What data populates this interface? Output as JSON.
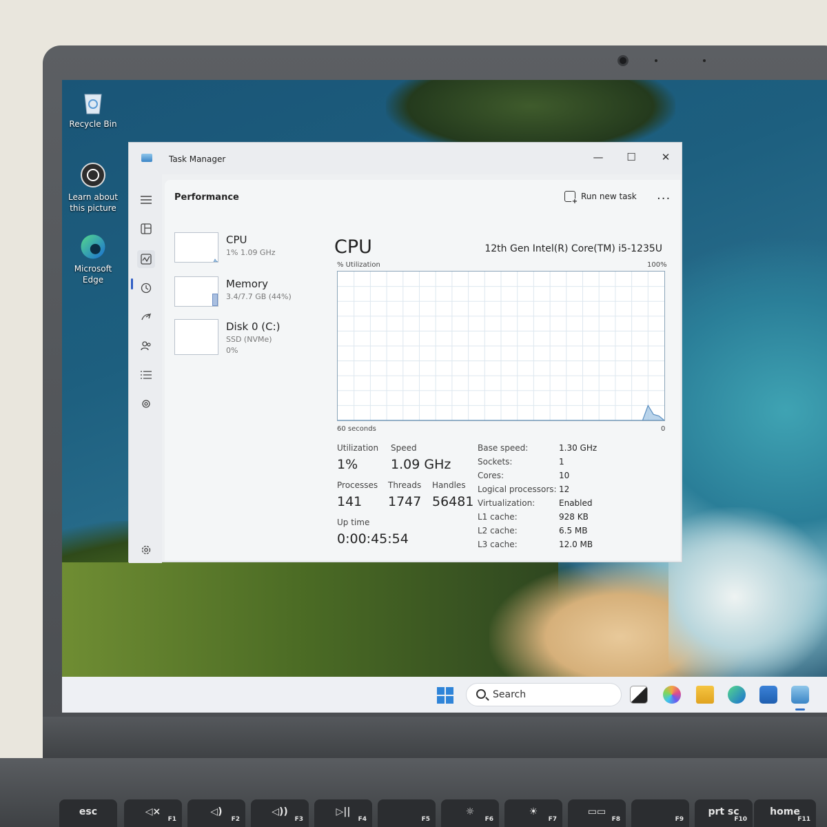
{
  "desktop": {
    "icons": [
      {
        "label": "Recycle Bin",
        "icon": "recycle-bin-icon"
      },
      {
        "label": "Learn about this picture",
        "icon": "camera-icon"
      },
      {
        "label": "Microsoft Edge",
        "icon": "edge-icon"
      }
    ]
  },
  "window": {
    "title": "Task Manager",
    "minimize": "—",
    "maximize": "☐",
    "close": "✕"
  },
  "toolbar": {
    "section": "Performance",
    "run_new_task": "Run new task",
    "more": "..."
  },
  "resources": [
    {
      "name": "CPU",
      "sub1": "1%  1.09 GHz",
      "sub2": ""
    },
    {
      "name": "Memory",
      "sub1": "3.4/7.7 GB (44%)",
      "sub2": ""
    },
    {
      "name": "Disk 0 (C:)",
      "sub1": "SSD (NVMe)",
      "sub2": "0%"
    }
  ],
  "detail": {
    "title": "CPU",
    "model": "12th Gen Intel(R) Core(TM) i5-1235U",
    "util_label": "% Utilization",
    "util_max": "100%",
    "time_label": "60 seconds",
    "time_min": "0"
  },
  "chart_data": {
    "type": "area",
    "x": [
      60,
      4,
      3,
      2,
      1,
      0
    ],
    "y": [
      0,
      0,
      10,
      4,
      3,
      0
    ],
    "ylim": [
      0,
      100
    ],
    "xlim": [
      60,
      0
    ],
    "grid": true
  },
  "stats": {
    "utilization_label": "Utilization",
    "utilization": "1%",
    "speed_label": "Speed",
    "speed": "1.09 GHz",
    "processes_label": "Processes",
    "processes": "141",
    "threads_label": "Threads",
    "threads": "1747",
    "handles_label": "Handles",
    "handles": "56481",
    "uptime_label": "Up time",
    "uptime": "0:00:45:54"
  },
  "specs": [
    {
      "label": "Base speed:",
      "value": "1.30 GHz"
    },
    {
      "label": "Sockets:",
      "value": "1"
    },
    {
      "label": "Cores:",
      "value": "10"
    },
    {
      "label": "Logical processors:",
      "value": "12"
    },
    {
      "label": "Virtualization:",
      "value": "Enabled"
    },
    {
      "label": "L1 cache:",
      "value": "928 KB"
    },
    {
      "label": "L2 cache:",
      "value": "6.5 MB"
    },
    {
      "label": "L3 cache:",
      "value": "12.0 MB"
    }
  ],
  "taskbar": {
    "search_label": "Search"
  },
  "keyboard": [
    {
      "label": "esc",
      "sub": ""
    },
    {
      "label": "◁×",
      "sub": "F1"
    },
    {
      "label": "◁)",
      "sub": "F2"
    },
    {
      "label": "◁))",
      "sub": "F3"
    },
    {
      "label": "▷||",
      "sub": "F4"
    },
    {
      "label": "",
      "sub": "F5"
    },
    {
      "label": "☼",
      "sub": "F6"
    },
    {
      "label": "☀",
      "sub": "F7"
    },
    {
      "label": "▭▭",
      "sub": "F8"
    },
    {
      "label": "",
      "sub": "F9"
    },
    {
      "label": "prt sc",
      "sub": "F10"
    },
    {
      "label": "home",
      "sub": "F11"
    }
  ],
  "colors": {
    "accent": "#2e5cc4",
    "graph_line": "#5b8fc0",
    "graph_fill": "#a9c9e6"
  }
}
